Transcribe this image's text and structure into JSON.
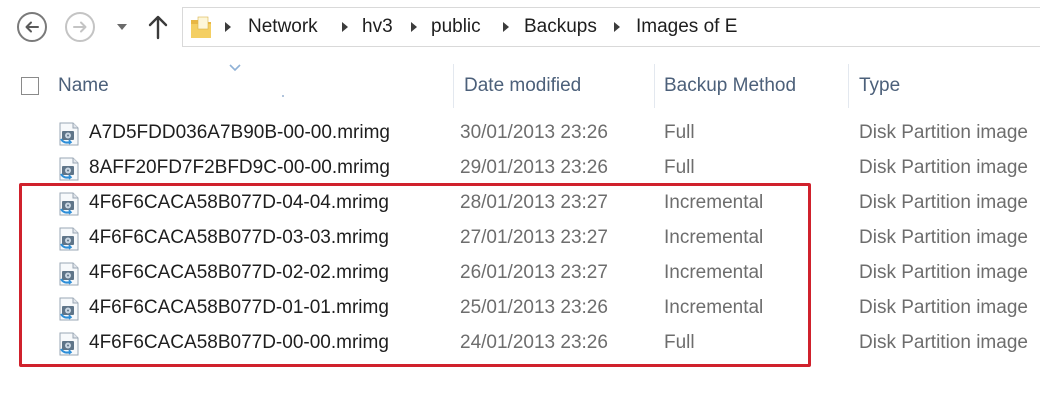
{
  "address_bar": {
    "crumbs": [
      "Network",
      "hv3",
      "public",
      "Backups",
      "Images of E"
    ]
  },
  "columns": {
    "name": "Name",
    "date": "Date modified",
    "method": "Backup Method",
    "type": "Type"
  },
  "files": [
    {
      "name": "A7D5FDD036A7B90B-00-00.mrimg",
      "date": "30/01/2013 23:26",
      "method": "Full",
      "type": "Disk Partition image"
    },
    {
      "name": "8AFF20FD7F2BFD9C-00-00.mrimg",
      "date": "29/01/2013 23:26",
      "method": "Full",
      "type": "Disk Partition image"
    },
    {
      "name": "4F6F6CACA58B077D-04-04.mrimg",
      "date": "28/01/2013 23:27",
      "method": "Incremental",
      "type": "Disk Partition image"
    },
    {
      "name": "4F6F6CACA58B077D-03-03.mrimg",
      "date": "27/01/2013 23:27",
      "method": "Incremental",
      "type": "Disk Partition image"
    },
    {
      "name": "4F6F6CACA58B077D-02-02.mrimg",
      "date": "26/01/2013 23:27",
      "method": "Incremental",
      "type": "Disk Partition image"
    },
    {
      "name": "4F6F6CACA58B077D-01-01.mrimg",
      "date": "25/01/2013 23:26",
      "method": "Incremental",
      "type": "Disk Partition image"
    },
    {
      "name": "4F6F6CACA58B077D-00-00.mrimg",
      "date": "24/01/2013 23:26",
      "method": "Full",
      "type": "Disk Partition image"
    }
  ],
  "icons": {
    "back": "back-arrow-icon",
    "forward": "forward-arrow-icon",
    "recent": "chevron-down-icon",
    "up": "up-arrow-icon",
    "folder": "folder-icon",
    "file": "disk-image-file-icon"
  },
  "colors": {
    "highlight": "#d0212c",
    "header_text": "#4c607a"
  }
}
